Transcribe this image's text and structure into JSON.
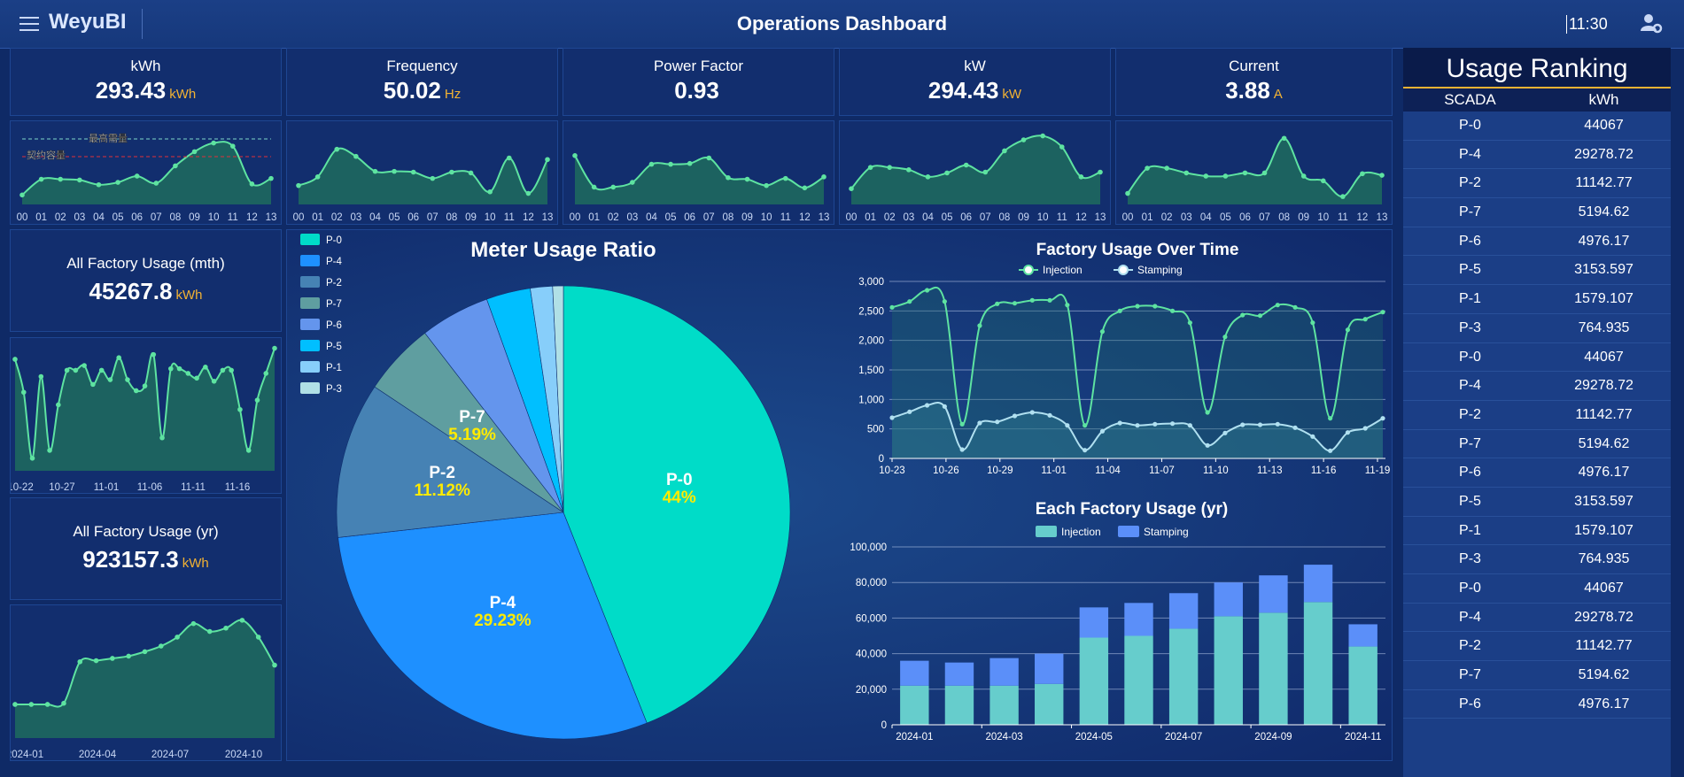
{
  "header": {
    "brand": "WeyuBI",
    "title": "Operations Dashboard",
    "time": "11:30"
  },
  "icons": {
    "menu": "hamburger-icon",
    "user": "user-settings-icon"
  },
  "colors": {
    "accent": "#f2b233",
    "line": "#5ee3a1",
    "fill": "#1e6b5e"
  },
  "kpis": [
    {
      "label": "kWh",
      "value": "293.43",
      "unit": "kWh"
    },
    {
      "label": "Frequency",
      "value": "50.02",
      "unit": "Hz"
    },
    {
      "label": "Power Factor",
      "value": "0.93",
      "unit": ""
    },
    {
      "label": "kW",
      "value": "294.43",
      "unit": "kW"
    },
    {
      "label": "Current",
      "value": "3.88",
      "unit": "A"
    }
  ],
  "mini_charts": {
    "x": [
      "00",
      "01",
      "02",
      "03",
      "04",
      "05",
      "06",
      "07",
      "08",
      "09",
      "10",
      "11",
      "12",
      "13"
    ],
    "markers": [
      "最高需量",
      "契约容量"
    ],
    "series": [
      [
        12,
        32,
        32,
        31,
        25,
        28,
        36,
        27,
        49,
        67,
        78,
        74,
        26,
        33
      ],
      [
        24,
        35,
        70,
        61,
        42,
        42,
        41,
        33,
        41,
        40,
        16,
        59,
        14,
        57
      ],
      [
        62,
        22,
        22,
        28,
        51,
        51,
        52,
        59,
        34,
        32,
        24,
        33,
        21,
        35
      ],
      [
        20,
        47,
        47,
        44,
        35,
        40,
        50,
        41,
        68,
        82,
        87,
        73,
        35,
        41
      ],
      [
        14,
        46,
        46,
        40,
        36,
        36,
        40,
        40,
        84,
        36,
        30,
        10,
        39,
        37,
        39
      ]
    ]
  },
  "monthly": {
    "label": "All Factory Usage (mth)",
    "value": "45267.8",
    "unit": "kWh",
    "chart_data": {
      "type": "area",
      "x": [
        "10-22",
        "10-27",
        "11-01",
        "11-06",
        "11-11",
        "11-16"
      ],
      "values": [
        71,
        50,
        8,
        60,
        13,
        42,
        64,
        64,
        67,
        55,
        64,
        58,
        72,
        58,
        51,
        54,
        74,
        21,
        65,
        65,
        62,
        59,
        66,
        57,
        64,
        64,
        39,
        13,
        45,
        62,
        78
      ]
    }
  },
  "yearly": {
    "label": "All Factory Usage (yr)",
    "value": "923157.3",
    "unit": "kWh",
    "chart_data": {
      "type": "area",
      "x": [
        "2024-01",
        "2024-04",
        "2024-07",
        "2024-10"
      ],
      "values": [
        30,
        30,
        30,
        31,
        68,
        69,
        71,
        73,
        77,
        82,
        90,
        102,
        95,
        98,
        105,
        90,
        65
      ]
    }
  },
  "pie": {
    "chart_data": {
      "type": "pie",
      "title": "Meter Usage Ratio",
      "slices": [
        {
          "name": "P-0",
          "pct": 44.0,
          "color": "#00dcc8",
          "label": "44%"
        },
        {
          "name": "P-4",
          "pct": 29.23,
          "color": "#1e90ff",
          "label": "29.23%"
        },
        {
          "name": "P-2",
          "pct": 11.12,
          "color": "#4682b4",
          "label": "11.12%"
        },
        {
          "name": "P-7",
          "pct": 5.19,
          "color": "#5f9ea0",
          "label": "5.19%"
        },
        {
          "name": "P-6",
          "pct": 4.97,
          "color": "#6495ed",
          "label": ""
        },
        {
          "name": "P-5",
          "pct": 3.15,
          "color": "#00bfff",
          "label": ""
        },
        {
          "name": "P-1",
          "pct": 1.58,
          "color": "#87cefa",
          "label": ""
        },
        {
          "name": "P-3",
          "pct": 0.76,
          "color": "#b0e0e6",
          "label": ""
        }
      ]
    }
  },
  "line": {
    "chart_data": {
      "type": "line",
      "title": "Factory Usage Over Time",
      "x_ticks": [
        "10-23",
        "10-26",
        "10-29",
        "11-01",
        "11-04",
        "11-07",
        "11-10",
        "11-13",
        "11-16",
        "11-19"
      ],
      "y_ticks": [
        "0",
        "500",
        "1,000",
        "1,500",
        "2,000",
        "2,500",
        "3,000"
      ],
      "ylim": [
        0,
        3000
      ],
      "series": [
        {
          "name": "Injection",
          "values": [
            2560,
            2660,
            2850,
            2660,
            580,
            2250,
            2620,
            2630,
            2680,
            2680,
            2600,
            560,
            2150,
            2500,
            2580,
            2580,
            2500,
            2300,
            780,
            2060,
            2430,
            2420,
            2600,
            2560,
            2300,
            680,
            2180,
            2360,
            2480
          ]
        },
        {
          "name": "Stamping",
          "values": [
            690,
            790,
            900,
            880,
            150,
            600,
            620,
            720,
            780,
            730,
            560,
            140,
            460,
            600,
            560,
            580,
            590,
            560,
            220,
            430,
            570,
            570,
            580,
            520,
            370,
            130,
            440,
            510,
            680
          ]
        }
      ]
    }
  },
  "bar": {
    "chart_data": {
      "type": "bar",
      "title": "Each Factory Usage (yr)",
      "categories": [
        "2024-01",
        "2024-02",
        "2024-03",
        "2024-04",
        "2024-05",
        "2024-06",
        "2024-07",
        "2024-08",
        "2024-09",
        "2024-10",
        "2024-11"
      ],
      "x_ticks": [
        "2024-01",
        "2024-03",
        "2024-05",
        "2024-07",
        "2024-09",
        "2024-11"
      ],
      "y_ticks": [
        "0",
        "20,000",
        "40,000",
        "60,000",
        "80,000",
        "100,000"
      ],
      "ylim": [
        0,
        100000
      ],
      "series": [
        {
          "name": "Injection",
          "values": [
            22000,
            22000,
            22000,
            23000,
            49000,
            50000,
            54000,
            61000,
            63000,
            69000,
            44000
          ]
        },
        {
          "name": "Stamping",
          "values": [
            14000,
            13000,
            15500,
            17000,
            17000,
            18500,
            20000,
            19000,
            21000,
            21000,
            12500
          ]
        }
      ]
    }
  },
  "ranking": {
    "title": "Usage Ranking",
    "col1": "SCADA",
    "col2": "kWh",
    "rows": [
      [
        "P-0",
        "44067"
      ],
      [
        "P-4",
        "29278.72"
      ],
      [
        "P-2",
        "11142.77"
      ],
      [
        "P-7",
        "5194.62"
      ],
      [
        "P-6",
        "4976.17"
      ],
      [
        "P-5",
        "3153.597"
      ],
      [
        "P-1",
        "1579.107"
      ],
      [
        "P-3",
        "764.935"
      ],
      [
        "P-0",
        "44067"
      ],
      [
        "P-4",
        "29278.72"
      ],
      [
        "P-2",
        "11142.77"
      ],
      [
        "P-7",
        "5194.62"
      ],
      [
        "P-6",
        "4976.17"
      ],
      [
        "P-5",
        "3153.597"
      ],
      [
        "P-1",
        "1579.107"
      ],
      [
        "P-3",
        "764.935"
      ],
      [
        "P-0",
        "44067"
      ],
      [
        "P-4",
        "29278.72"
      ],
      [
        "P-2",
        "11142.77"
      ],
      [
        "P-7",
        "5194.62"
      ],
      [
        "P-6",
        "4976.17"
      ]
    ]
  }
}
